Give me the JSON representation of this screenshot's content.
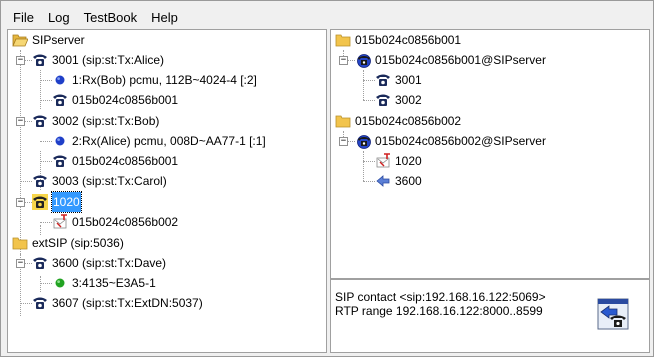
{
  "menu": [
    "File",
    "Log",
    "TestBook",
    "Help"
  ],
  "left_tree": [
    {
      "label": "SIPserver",
      "icon": "folder-open-icon"
    },
    {
      "label": "3001 (sip:st:Tx:Alice)",
      "icon": "phone-icon"
    },
    {
      "label": "1:Rx(Bob) pcmu, 112B~4024-4 [:2]",
      "icon": "blue-dot-icon"
    },
    {
      "label": "015b024c0856b001",
      "icon": "phone-icon"
    },
    {
      "label": "3002 (sip:st:Tx:Bob)",
      "icon": "phone-icon"
    },
    {
      "label": "2:Rx(Alice) pcmu, 008D~AA77-1 [:1]",
      "icon": "blue-dot-icon"
    },
    {
      "label": "015b024c0856b001",
      "icon": "phone-icon"
    },
    {
      "label": "3003 (sip:st:Tx:Carol)",
      "icon": "phone-icon"
    },
    {
      "label": "1020",
      "icon": "phone-yellow-icon"
    },
    {
      "label": "015b024c0856b002",
      "icon": "incoming-call-icon"
    },
    {
      "label": "extSIP (sip:5036)",
      "icon": "folder-icon"
    },
    {
      "label": "3600 (sip:st:Tx:Dave)",
      "icon": "phone-icon"
    },
    {
      "label": "3:4135~E3A5-1",
      "icon": "green-dot-icon"
    },
    {
      "label": "3607 (sip:st:Tx:ExtDN:5037)",
      "icon": "phone-icon"
    }
  ],
  "right_tree": [
    {
      "label": "015b024c0856b001",
      "icon": "folder-icon"
    },
    {
      "label": "015b024c0856b001@SIPserver",
      "icon": "conference-icon"
    },
    {
      "label": "3001",
      "icon": "phone-icon"
    },
    {
      "label": "3002",
      "icon": "phone-icon"
    },
    {
      "label": "015b024c0856b002",
      "icon": "folder-icon"
    },
    {
      "label": "015b024c0856b002@SIPserver",
      "icon": "conference-icon"
    },
    {
      "label": "1020",
      "icon": "incoming-call-icon"
    },
    {
      "label": "3600",
      "icon": "transfer-icon"
    }
  ],
  "status": {
    "contact": "SIP contact <sip:192.168.16.122:5069>",
    "rtp": "RTP range 192.168.16.122:8000..8599"
  },
  "colors": {
    "selection": "#3399ff",
    "phone": "#1a2a5a",
    "blue_dot": "#1f3fc8",
    "green_dot": "#22a322",
    "folder": "#f2c44c"
  }
}
